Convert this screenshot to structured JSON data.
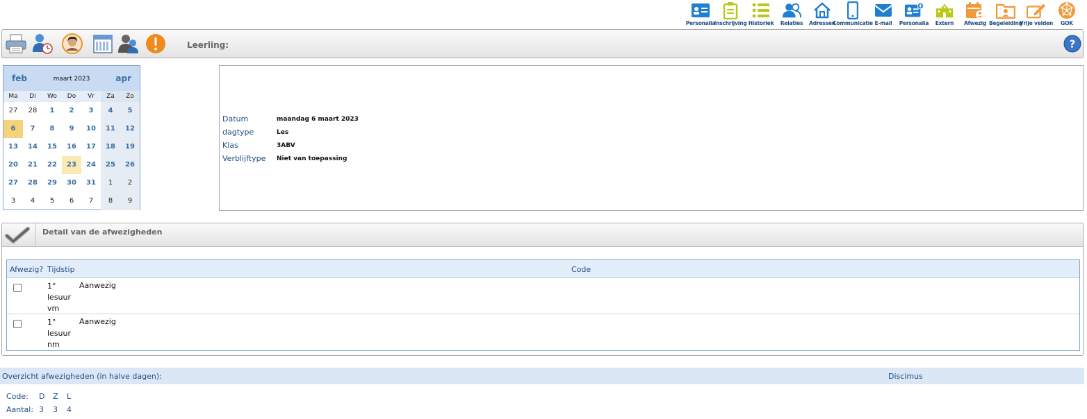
{
  "nav": [
    {
      "label": "Personalia",
      "icon": "id-card-icon",
      "color": "#1f7fd1"
    },
    {
      "label": "Inschrijving",
      "icon": "clipboard-icon",
      "color": "#b9c91a"
    },
    {
      "label": "Historiek",
      "icon": "list-icon",
      "color": "#b9c91a"
    },
    {
      "label": "Relaties",
      "icon": "people-icon",
      "color": "#1f7fd1"
    },
    {
      "label": "Adressen",
      "icon": "house-icon",
      "color": "#1f7fd1"
    },
    {
      "label": "Communicatie",
      "icon": "phone-icon",
      "color": "#1f7fd1"
    },
    {
      "label": "E-mail",
      "icon": "envelope-icon",
      "color": "#1f7fd1"
    },
    {
      "label": "Personalia",
      "icon": "id-card-plus-icon",
      "color": "#1f7fd1"
    },
    {
      "label": "Extern",
      "icon": "school-icon",
      "color": "#b9c91a"
    },
    {
      "label": "Afwezig",
      "icon": "calendar-person-icon",
      "color": "#f29a3a"
    },
    {
      "label": "Begeleiding",
      "icon": "folder-person-icon",
      "color": "#f29a3a"
    },
    {
      "label": "Vrije velden",
      "icon": "pencil-edit-icon",
      "color": "#f29a3a"
    },
    {
      "label": "GOK",
      "icon": "network-ball-icon",
      "color": "#f29a3a"
    }
  ],
  "toolbar": {
    "leerling_label": "Leerling:"
  },
  "calendar": {
    "prev": "feb",
    "next": "apr",
    "title": "maart 2023",
    "weekdays": [
      "Ma",
      "Di",
      "Wo",
      "Do",
      "Vr",
      "Za",
      "Zo"
    ],
    "weeks": [
      [
        "27",
        "28",
        "1",
        "2",
        "3",
        "4",
        "5"
      ],
      [
        "6",
        "7",
        "8",
        "9",
        "10",
        "11",
        "12"
      ],
      [
        "13",
        "14",
        "15",
        "16",
        "17",
        "18",
        "19"
      ],
      [
        "20",
        "21",
        "22",
        "23",
        "24",
        "25",
        "26"
      ],
      [
        "27",
        "28",
        "29",
        "30",
        "31",
        "1",
        "2"
      ],
      [
        "3",
        "4",
        "5",
        "6",
        "7",
        "8",
        "9"
      ]
    ],
    "selected_day": "6",
    "today_day": "23"
  },
  "info": {
    "rows": [
      {
        "key": "Datum",
        "value": "maandag 6 maart 2023"
      },
      {
        "key": "dagtype",
        "value": "Les"
      },
      {
        "key": "Klas",
        "value": "3ABV"
      },
      {
        "key": "Verblijftype",
        "value": "Niet van toepassing"
      }
    ]
  },
  "detail": {
    "title": "Detail van de afwezigheden",
    "columns": {
      "afwezig": "Afwezig?",
      "tijdstip": "Tijdstip",
      "code": "Code"
    },
    "rows": [
      {
        "tijdstip": "1° lesuur vm",
        "code": "Aanwezig",
        "checked": false
      },
      {
        "tijdstip": "1° lesuur nm",
        "code": "Aanwezig",
        "checked": false
      }
    ]
  },
  "overview": {
    "title": "Overzicht afwezigheden (in halve dagen):",
    "source": "Discimus",
    "code_label": "Code:",
    "count_label": "Aantal:",
    "codes": [
      "D",
      "Z",
      "L"
    ],
    "counts": [
      "3",
      "3",
      "4"
    ]
  }
}
